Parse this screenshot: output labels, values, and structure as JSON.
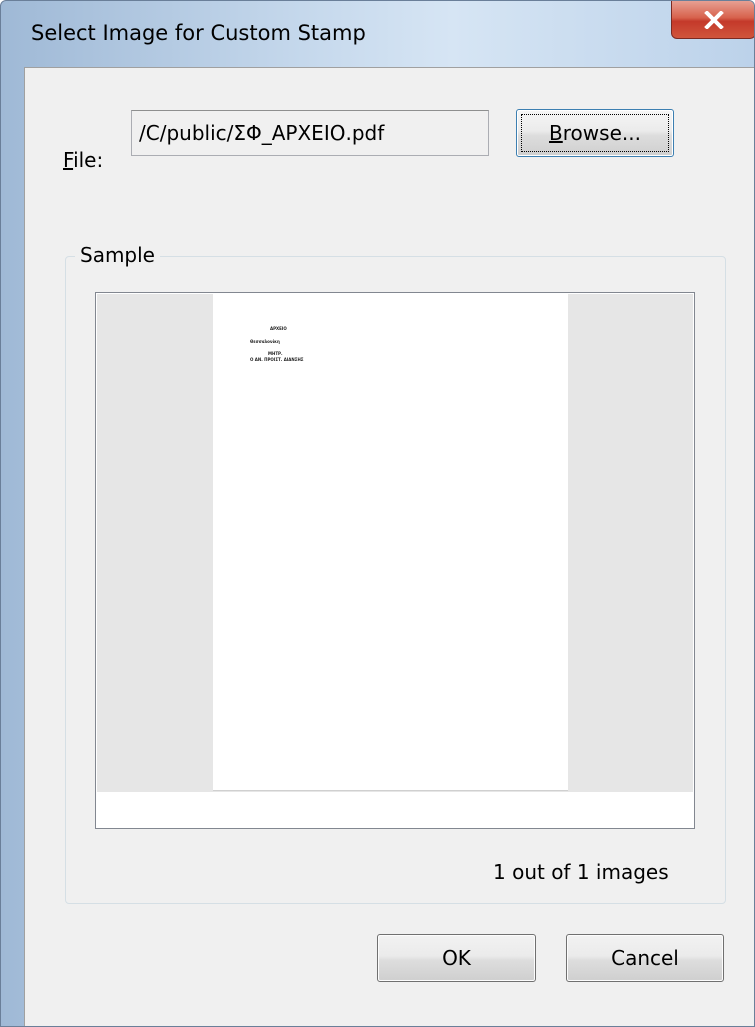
{
  "window": {
    "title": "Select Image for Custom Stamp",
    "close_icon": "close-icon"
  },
  "file": {
    "label_mnemonic": "F",
    "label_rest": "ile:",
    "value": "/C/public/ΣΦ_ΑΡΧΕΙΟ.pdf",
    "browse_mnemonic": "B",
    "browse_rest": "rowse..."
  },
  "sample": {
    "legend": "Sample",
    "preview_lines": [
      "ΑΡΧΕΙΟ",
      "Θεσσαλονίκη",
      "ΜΗΤΡ.",
      "Ο ΑΝ. ΠΡΟΙΣΤ. ΔΙΑΝΣΗΣ"
    ],
    "image_count": "1 out of 1 images"
  },
  "buttons": {
    "ok": "OK",
    "cancel": "Cancel"
  }
}
